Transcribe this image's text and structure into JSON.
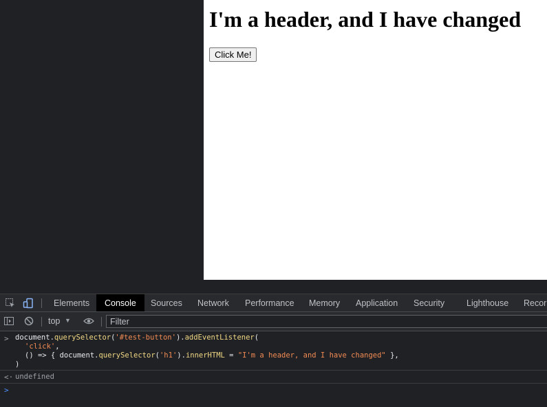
{
  "page": {
    "heading": "I'm a header, and I have changed",
    "button_label": "Click Me!"
  },
  "devtools": {
    "tabs": [
      "Elements",
      "Console",
      "Sources",
      "Network",
      "Performance",
      "Memory",
      "Application",
      "Security",
      "Lighthouse",
      "Recor"
    ],
    "active_tab": "Console",
    "toolbar": {
      "context": "top",
      "filter_placeholder": "Filter"
    },
    "console": {
      "input_line1_a": "document.",
      "input_line1_fn1": "querySelector",
      "input_line1_b": "(",
      "input_line1_str": "'#test-button'",
      "input_line1_c": ").",
      "input_line1_fn2": "addEventListener",
      "input_line1_d": "(",
      "input_line2": "'click'",
      "input_line2_tail": ",",
      "input_line3_a": "() => { document.",
      "input_line3_fn": "querySelector",
      "input_line3_b": "(",
      "input_line3_str": "'h1'",
      "input_line3_c": ").",
      "input_line3_prop": "innerHTML",
      "input_line3_d": " = ",
      "input_line3_val": "\"I'm a header, and I have changed\"",
      "input_line3_e": " },",
      "input_line4": ")",
      "result": "undefined"
    }
  },
  "colors": {
    "devtools_bg": "#202124",
    "active_tab_bg": "#000000",
    "function_color": "#f0d784",
    "string_color": "#f28b54",
    "inspect_active": "#8ab4f8"
  }
}
